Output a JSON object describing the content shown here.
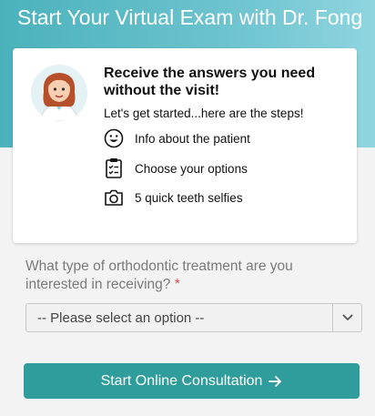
{
  "header": {
    "title": "Start Your Virtual Exam with Dr. Fong"
  },
  "card": {
    "heading": "Receive the answers you need without the visit!",
    "subheading": "Let's get started...here are the steps!",
    "steps": [
      {
        "label": "Info about the patient",
        "icon": "smiley-icon"
      },
      {
        "label": "Choose your options",
        "icon": "clipboard-checklist-icon"
      },
      {
        "label": "5 quick teeth selfies",
        "icon": "camera-icon"
      }
    ]
  },
  "form": {
    "question": "What type of orthodontic treatment are you interested in receiving?",
    "required_marker": "*",
    "select": {
      "selected": "-- Please select an option --"
    }
  },
  "cta": {
    "label": "Start Online Consultation"
  },
  "colors": {
    "hero_start": "#4bb2bc",
    "hero_end": "#8fd5e0",
    "button": "#2f9d9b",
    "required": "#d9534f"
  }
}
